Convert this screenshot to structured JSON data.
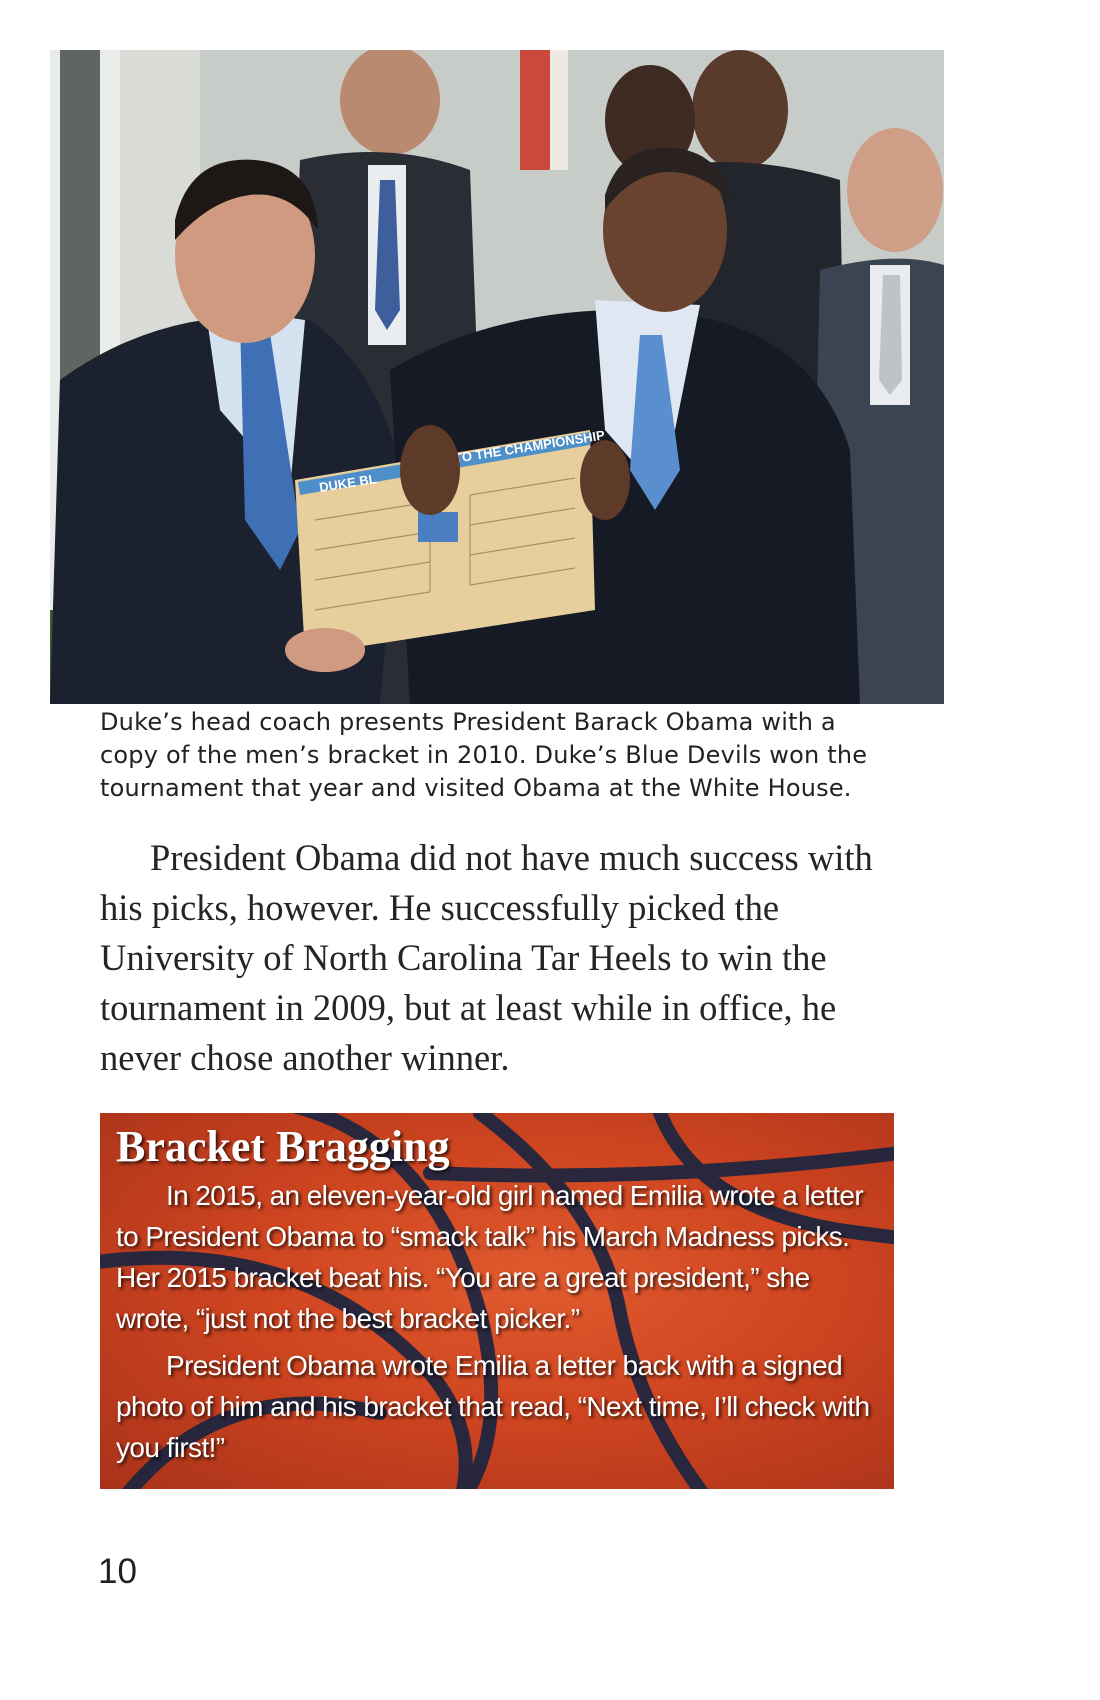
{
  "photo": {
    "alt": "Duke coach and President Obama holding a bracket board in front of team members",
    "board_text_left": "DUKE BL",
    "board_text_right": "TO THE CHAMPIONSHIP"
  },
  "caption": "Duke’s head coach presents President Barack Obama with a copy of the men’s bracket in 2010. Duke’s Blue Devils won the tournament that year and visited Obama at the White House.",
  "body_paragraph": "President Obama did not have much success with his picks, however. He successfully picked the University of North Carolina Tar Heels to win the tournament in 2009, but at least while in office, he never chose another winner.",
  "sidebar": {
    "title": "Bracket Bragging",
    "paragraphs": [
      "In 2015, an eleven-year-old girl named Emilia wrote a letter to President Obama to “smack talk” his March Madness picks. Her 2015 bracket beat his. “You are a great president,” she wrote, “just not the best bracket picker.”",
      "President Obama wrote Emilia a letter back with a signed photo of him and his bracket that read, “Next time, I’ll check with you first!”"
    ],
    "accent_color": "#cf4520"
  },
  "page_number": "10"
}
